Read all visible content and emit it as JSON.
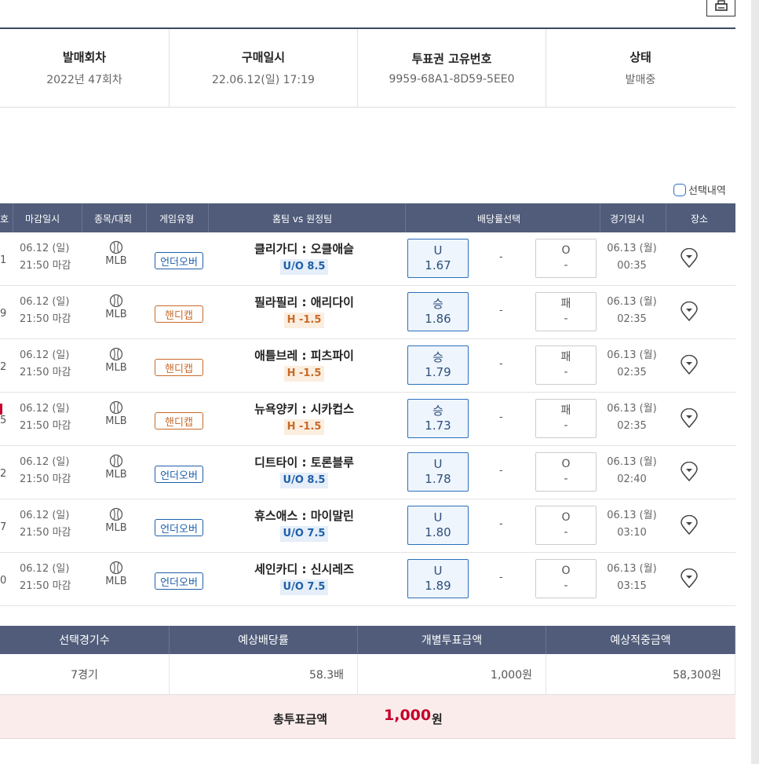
{
  "print_icon": "print-icon",
  "info": {
    "headers": [
      "발매회차",
      "구매일시",
      "투표권 고유번호",
      "상태"
    ],
    "values": [
      "2022년 47회차",
      "22.06.12(일) 17:19",
      "9959-68A1-8D59-5EE0",
      "발매중"
    ]
  },
  "legend_label": "선택내역",
  "columns": {
    "no": "호",
    "deadline": "마감일시",
    "sport": "종목/대회",
    "gtype": "게임유형",
    "teams": "홈팀 vs 원정팀",
    "odds": "배당률선택",
    "gdate": "경기일시",
    "place": "장소"
  },
  "rows": [
    {
      "no": "1",
      "deadline_date": "06.12 (일)",
      "deadline_time": "21:50 마감",
      "league": "MLB",
      "gtype": "언더오버",
      "gkind": "uo",
      "teams": "클리가디 : 오클애슬",
      "line": "U/O 8.5",
      "a_label": "U",
      "a_odds": "1.67",
      "mid": "-",
      "b_label": "O",
      "b_odds": "-",
      "gdate": "06.13 (월)",
      "gtime": "00:35"
    },
    {
      "no": "9",
      "deadline_date": "06.12 (일)",
      "deadline_time": "21:50 마감",
      "league": "MLB",
      "gtype": "핸디캡",
      "gkind": "hc",
      "teams": "필라필리 : 애리다이",
      "line": "H -1.5",
      "a_label": "승",
      "a_odds": "1.86",
      "mid": "-",
      "b_label": "패",
      "b_odds": "-",
      "gdate": "06.13 (월)",
      "gtime": "02:35"
    },
    {
      "no": "2",
      "deadline_date": "06.12 (일)",
      "deadline_time": "21:50 마감",
      "league": "MLB",
      "gtype": "핸디캡",
      "gkind": "hc",
      "teams": "애틀브레 : 피츠파이",
      "line": "H -1.5",
      "a_label": "승",
      "a_odds": "1.79",
      "mid": "-",
      "b_label": "패",
      "b_odds": "-",
      "gdate": "06.13 (월)",
      "gtime": "02:35"
    },
    {
      "no": "5",
      "deadline_date": "06.12 (일)",
      "deadline_time": "21:50 마감",
      "league": "MLB",
      "gtype": "핸디캡",
      "gkind": "hc",
      "teams": "뉴욕양키 : 시카컵스",
      "line": "H -1.5",
      "a_label": "승",
      "a_odds": "1.73",
      "mid": "-",
      "b_label": "패",
      "b_odds": "-",
      "gdate": "06.13 (월)",
      "gtime": "02:35"
    },
    {
      "no": "2",
      "deadline_date": "06.12 (일)",
      "deadline_time": "21:50 마감",
      "league": "MLB",
      "gtype": "언더오버",
      "gkind": "uo",
      "teams": "디트타이 : 토론블루",
      "line": "U/O 8.5",
      "a_label": "U",
      "a_odds": "1.78",
      "mid": "-",
      "b_label": "O",
      "b_odds": "-",
      "gdate": "06.13 (월)",
      "gtime": "02:40"
    },
    {
      "no": "7",
      "deadline_date": "06.12 (일)",
      "deadline_time": "21:50 마감",
      "league": "MLB",
      "gtype": "언더오버",
      "gkind": "uo",
      "teams": "휴스애스 : 마이말린",
      "line": "U/O 7.5",
      "a_label": "U",
      "a_odds": "1.80",
      "mid": "-",
      "b_label": "O",
      "b_odds": "-",
      "gdate": "06.13 (월)",
      "gtime": "03:10"
    },
    {
      "no": "0",
      "deadline_date": "06.12 (일)",
      "deadline_time": "21:50 마감",
      "league": "MLB",
      "gtype": "언더오버",
      "gkind": "uo",
      "teams": "세인카디 : 신시레즈",
      "line": "U/O 7.5",
      "a_label": "U",
      "a_odds": "1.89",
      "mid": "-",
      "b_label": "O",
      "b_odds": "-",
      "gdate": "06.13 (월)",
      "gtime": "03:15"
    }
  ],
  "summary": {
    "headers": [
      "선택경기수",
      "예상배당률",
      "개별투표금액",
      "예상적중금액"
    ],
    "values": [
      "7경기",
      "58.3배",
      "1,000원",
      "58,300원"
    ]
  },
  "total": {
    "label": "총투표금액",
    "amount": "1,000",
    "unit": "원"
  },
  "colors": {
    "header_bg": "#505c7a",
    "accent_red": "#c5002b",
    "uo_blue": "#1f5fa8",
    "handicap_orange": "#c86a2a"
  }
}
